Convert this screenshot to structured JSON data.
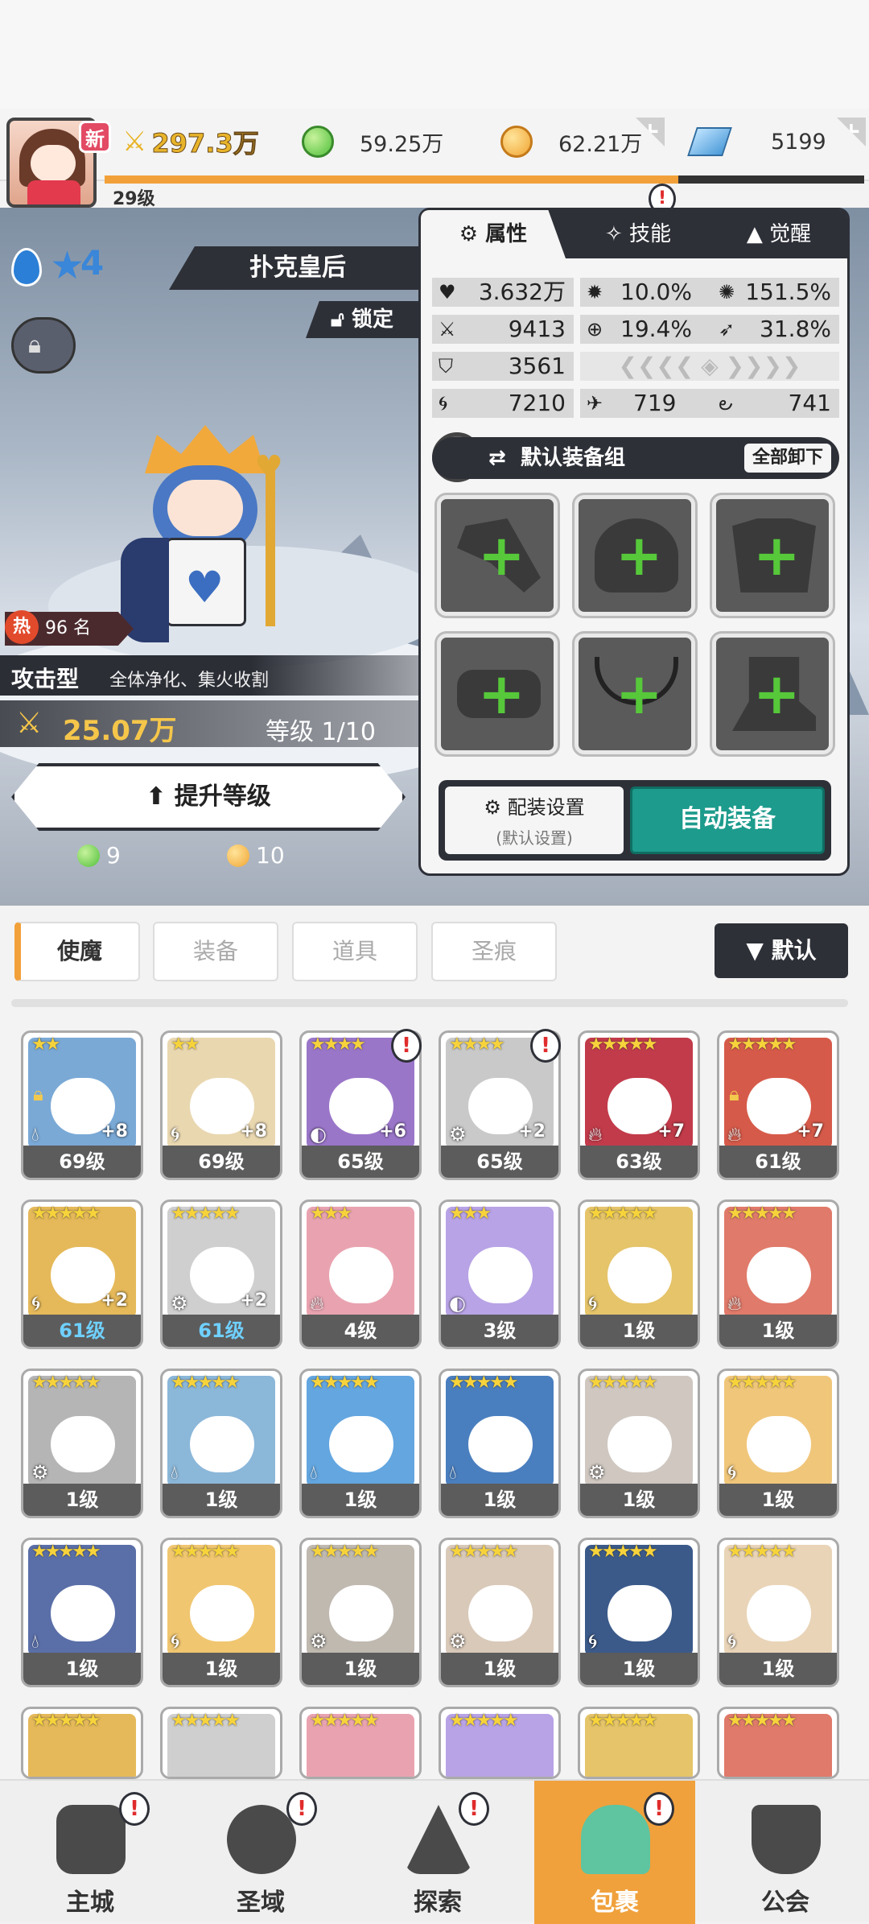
{
  "top": {
    "new_badge": "新",
    "power": "297.3万",
    "green_currency": "59.25万",
    "gold_currency": "62.21万",
    "crystal_currency": "5199",
    "level": "29级",
    "level_progress": 0.755
  },
  "hero": {
    "star_count": "4",
    "name": "扑克皇后",
    "lock_label": "锁定",
    "rank": "96 名",
    "hot_label": "热",
    "type": "攻击型",
    "description": "全体净化、集火收割",
    "power": "25.07万",
    "level": "等级 1/10",
    "upgrade_label": "提升等级",
    "cost_green": "9",
    "cost_gold": "10"
  },
  "panel": {
    "tabs": [
      "属性",
      "技能",
      "觉醒"
    ],
    "stats": {
      "hp": "3.632万",
      "crit_rate": "10.0%",
      "crit_dmg": "151.5%",
      "atk": "9413",
      "hit": "19.4%",
      "dodge": "31.8%",
      "def": "3561",
      "speed": "7210",
      "stat_a": "719",
      "stat_b": "741"
    },
    "equip_group": "默认装备组",
    "unequip_all": "全部卸下",
    "config_label": "配装设置",
    "config_sub": "(默认设置)",
    "auto_equip": "自动装备"
  },
  "filter": {
    "tabs": [
      "使魔",
      "装备",
      "道具",
      "圣痕"
    ],
    "sort": "▼ 默认"
  },
  "cards": [
    {
      "lvl": "69级",
      "stars": "★★",
      "plus": "+8"
    },
    {
      "lvl": "69级",
      "stars": "★★",
      "plus": "+8"
    },
    {
      "lvl": "65级",
      "stars": "★★★★",
      "plus": "+6"
    },
    {
      "lvl": "65级",
      "stars": "★★★★",
      "plus": "+2"
    },
    {
      "lvl": "63级",
      "stars": "★★★★★",
      "plus": "+7"
    },
    {
      "lvl": "61级",
      "stars": "★★★★★",
      "plus": "+7"
    },
    {
      "lvl": "61级",
      "stars": "★★★★★",
      "plus": "+2"
    },
    {
      "lvl": "61级",
      "stars": "★★★★★",
      "plus": "+2"
    },
    {
      "lvl": "4级",
      "stars": "★★★",
      "plus": ""
    },
    {
      "lvl": "3级",
      "stars": "★★★",
      "plus": ""
    },
    {
      "lvl": "1级",
      "stars": "★★★★★",
      "plus": ""
    },
    {
      "lvl": "1级",
      "stars": "★★★★★",
      "plus": ""
    },
    {
      "lvl": "1级",
      "stars": "★★★★★",
      "plus": ""
    },
    {
      "lvl": "1级",
      "stars": "★★★★★",
      "plus": ""
    },
    {
      "lvl": "1级",
      "stars": "★★★★★",
      "plus": ""
    },
    {
      "lvl": "1级",
      "stars": "★★★★★",
      "plus": ""
    },
    {
      "lvl": "1级",
      "stars": "★★★★★",
      "plus": ""
    },
    {
      "lvl": "1级",
      "stars": "★★★★★",
      "plus": ""
    },
    {
      "lvl": "1级",
      "stars": "★★★★★",
      "plus": ""
    },
    {
      "lvl": "1级",
      "stars": "★★★★★",
      "plus": ""
    },
    {
      "lvl": "1级",
      "stars": "★★★★★",
      "plus": ""
    },
    {
      "lvl": "1级",
      "stars": "★★★★★",
      "plus": ""
    },
    {
      "lvl": "1级",
      "stars": "★★★★★",
      "plus": ""
    },
    {
      "lvl": "1级",
      "stars": "★★★★★",
      "plus": ""
    }
  ],
  "nav": [
    "主城",
    "圣域",
    "探索",
    "包裹",
    "公会"
  ],
  "colors": {
    "accent": "#f2a03a",
    "dark": "#2e3038",
    "teal": "#1d9b8c"
  }
}
